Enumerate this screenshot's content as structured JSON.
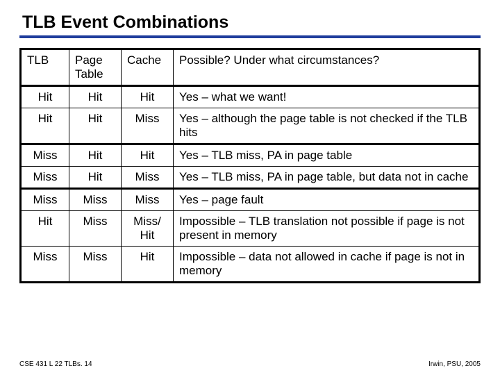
{
  "title": "TLB Event Combinations",
  "headers": {
    "tlb": "TLB",
    "page_table": "Page Table",
    "cache": "Cache",
    "possible": "Possible?  Under what circumstances?"
  },
  "rows": [
    {
      "tlb": "Hit",
      "pt": "Hit",
      "cache": "Hit",
      "desc": "Yes – what we want!"
    },
    {
      "tlb": "Hit",
      "pt": "Hit",
      "cache": "Miss",
      "desc": "Yes – although the page table is not checked if the TLB hits"
    },
    {
      "tlb": "Miss",
      "pt": "Hit",
      "cache": "Hit",
      "desc": "Yes – TLB miss, PA in page table"
    },
    {
      "tlb": "Miss",
      "pt": "Hit",
      "cache": "Miss",
      "desc": "Yes – TLB miss, PA in page table, but data not in cache"
    },
    {
      "tlb": "Miss",
      "pt": "Miss",
      "cache": "Miss",
      "desc": "Yes – page fault"
    },
    {
      "tlb": "Hit",
      "pt": "Miss",
      "cache": "Miss/ Hit",
      "desc": "Impossible – TLB translation not possible if page is not present in memory"
    },
    {
      "tlb": "Miss",
      "pt": "Miss",
      "cache": "Hit",
      "desc": "Impossible – data not allowed in cache if page is not in memory"
    }
  ],
  "footer": {
    "left": "CSE 431  L 22  TLBs. 14",
    "right": "Irwin, PSU, 2005"
  },
  "chart_data": {
    "type": "table",
    "title": "TLB Event Combinations",
    "columns": [
      "TLB",
      "Page Table",
      "Cache",
      "Possible? Under what circumstances?"
    ],
    "rows": [
      [
        "Hit",
        "Hit",
        "Hit",
        "Yes – what we want!"
      ],
      [
        "Hit",
        "Hit",
        "Miss",
        "Yes – although the page table is not checked if the TLB hits"
      ],
      [
        "Miss",
        "Hit",
        "Hit",
        "Yes – TLB miss, PA in page table"
      ],
      [
        "Miss",
        "Hit",
        "Miss",
        "Yes – TLB miss, PA in page table, but data not in cache"
      ],
      [
        "Miss",
        "Miss",
        "Miss",
        "Yes – page fault"
      ],
      [
        "Hit",
        "Miss",
        "Miss/Hit",
        "Impossible – TLB translation not possible if page is not present in memory"
      ],
      [
        "Miss",
        "Miss",
        "Hit",
        "Impossible – data not allowed in cache if page is not in memory"
      ]
    ]
  }
}
